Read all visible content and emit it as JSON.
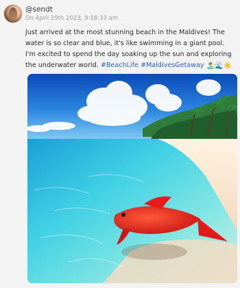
{
  "post": {
    "username": "@sendt",
    "timestamp": "On April 29th 2023, 9:58:33 am",
    "body_text": "Just arrived at the most stunning beach in the Maldives! The water is so clear and blue, it's like swimming in a giant pool. I'm excited to spend the day soaking up the sun and exploring the underwater world.",
    "hashtags": [
      "#BeachLife",
      "#MaldivesGetaway"
    ],
    "emojis": [
      "🏝️",
      "🌊",
      "☀️"
    ]
  },
  "icons": {
    "avatar": "user-avatar"
  },
  "colors": {
    "background": "#f3f3f3",
    "hashtag": "#2b62c4",
    "timestamp": "#9a9a9a",
    "text": "#2b2b2b"
  }
}
